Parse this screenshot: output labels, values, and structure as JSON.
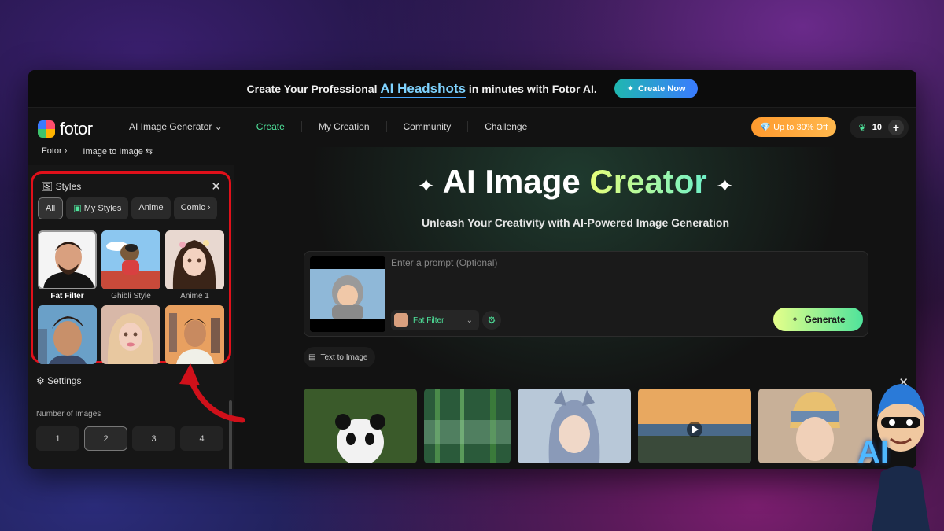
{
  "banner": {
    "text_before": "Create Your Professional",
    "highlight": "AI Headshots",
    "text_after": "in minutes with Fotor AI.",
    "cta": "Create Now"
  },
  "logo": {
    "text": "fotor"
  },
  "nav": {
    "generator_menu": "AI Image Generator",
    "items": [
      "Create",
      "My Creation",
      "Community",
      "Challenge"
    ]
  },
  "offer": "Up to 30% Off",
  "credits": "10",
  "breadcrumb": {
    "home": "Fotor",
    "current": "Image to Image"
  },
  "styles": {
    "title": "Styles",
    "chips": [
      "All",
      "My Styles",
      "Anime",
      "Comic"
    ],
    "tiles": [
      {
        "label": "Fat Filter"
      },
      {
        "label": "Ghibli Style"
      },
      {
        "label": "Anime 1"
      }
    ]
  },
  "settings": {
    "title": "Settings",
    "num_label": "Number of Images",
    "options": [
      "1",
      "2",
      "3",
      "4"
    ],
    "selected": "2"
  },
  "hero": {
    "title_plain": "AI Image ",
    "title_grad": "Creator",
    "subtitle": "Unleash Your Creativity with AI-Powered Image Generation"
  },
  "prompt": {
    "placeholder": "Enter a prompt (Optional)",
    "style": "Fat Filter",
    "generate": "Generate"
  },
  "text_to_image": "Text to Image",
  "mascot_text": "AI",
  "colors": {
    "accent_green": "#4fe39b",
    "highlight_red": "#e0101a",
    "offer_orange": "#ff9a2e"
  }
}
